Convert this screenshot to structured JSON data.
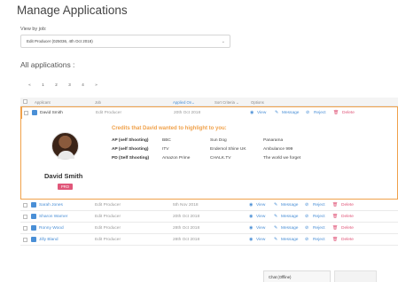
{
  "page": {
    "title": "Manage Applications",
    "view_by_label": "View by job:",
    "job_select_value": "Edit Producer (025036, 4th Oct 2018)",
    "all_label": "All applications :"
  },
  "pagination": [
    "«",
    "1",
    "2",
    "3",
    "4",
    "»"
  ],
  "table": {
    "headers": {
      "applicant": "Applicant",
      "job": "Job",
      "applied_on": "Applied On",
      "sort_criteria": "Sort Criteria",
      "options": "Options"
    },
    "actions": {
      "view": "View",
      "message": "Message",
      "reject": "Reject",
      "delete": "Delete"
    },
    "expanded_row": {
      "name": "David Smith",
      "job": "Edit Producer",
      "date": "20th Oct 2018"
    },
    "rows": [
      {
        "name": "Sarah Jones",
        "job": "Edit Producer",
        "date": "5th Nov 2018"
      },
      {
        "name": "Sharon Warner",
        "job": "Edit Producer",
        "date": "20th Oct 2018"
      },
      {
        "name": "Ronny Wood",
        "job": "Edit Producer",
        "date": "28th Oct 2018"
      },
      {
        "name": "Jilly Bland",
        "job": "Edit Producer",
        "date": "28th Oct 2018"
      }
    ]
  },
  "detail": {
    "candidate_name": "David Smith",
    "badge": "PRO",
    "credits_title": "Credits that David wanted to highlight to you:",
    "credits": [
      {
        "role": "AP (self Shooting)",
        "channel": "BBC",
        "company": "Sun Dog",
        "title": "Panarama"
      },
      {
        "role": "AP (self Shooting)",
        "channel": "ITV",
        "company": "Endemol Shine UK",
        "title": "Ambulance 999"
      },
      {
        "role": "PD (Self Shooting)",
        "channel": "Amazon Prime",
        "company": "CHALK.TV",
        "title": "The world we forget"
      }
    ]
  },
  "chat": {
    "label": "Chat (Offline)"
  },
  "colors": {
    "accent": "#4a8fd6",
    "highlight": "#f0a14a",
    "danger": "#e0577a"
  }
}
